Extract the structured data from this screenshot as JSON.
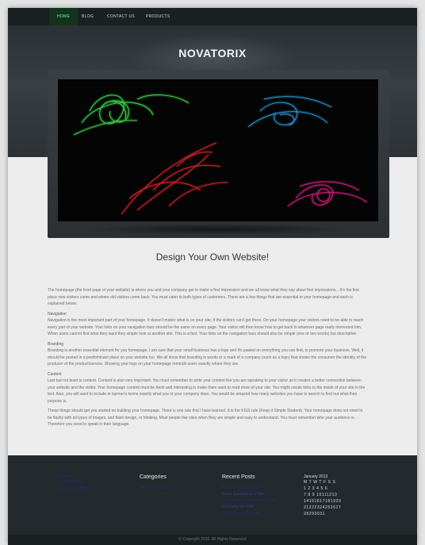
{
  "nav": {
    "items": [
      "HOME",
      "BLOG",
      "CONTACT US",
      "PRODUCTS"
    ]
  },
  "header": {
    "logo": "NOVATORIX"
  },
  "main": {
    "tagline": "Design Your Own Website!",
    "intro": "The homepage (the front page of your website) is where you and your company get to make a first impression and we all know what they say about first impressions... It's the first place new visitors come and where old visitors come back. You must cater to both types of customers. There are a few things that are essential to your homepage and each is explained below.",
    "sections": [
      {
        "heading": "Navigation",
        "text": "Navigation is the most important part of your homepage. It doesn't matter what is on your site, if the visitors can't get there. On your homepage your visitors need to be able to reach every part of your website. Your links on your navigation bars should be the same on every page. Your visitor will then know how to get back to whatever page really interested him. When users cannot find what they want they simple look at another site. This is a fact. Your links on the navigation bars should also be simple (one or two words) but descriptive."
      },
      {
        "heading": "Branding",
        "text": "Branding is another essential element for you homepage. I am sure that your small business has a logo and it's pasted on everything you can find, to promote your business. Well, it should be posted in a predominant place on your website too. We all know that branding is words or a mark of a company (such as a logo) that shows the consumer the identity of the producer of the product/service. Showing your logo on your homepage reminds users exactly where they are."
      },
      {
        "heading": "Content",
        "text": "Last but not least is content. Content is also very important. You must remember to write your content like you are speaking to your visitor as it creates a better connection between your website and the visitor. Your homepage content must be fresh and interesting to make them want to read more of your site. You might create links to the inside of your site in the text. Also, you will want to include in layman's terms exactly what you or your company does. You would be amazed how many websites you have to search to find out what their purpose is."
      }
    ],
    "closing": "These things should get you started on building your homepage. There is one rule that I have learned. It is the KISS rule (Keep it Simple Student). Your homepage does not need to be flashy with all types of images, and flash design, or blinking. Most people like sites when they are simple and easy to understand. You must remember who your audience is. Therefore you need to speak in their language."
  },
  "footer": {
    "links_col": [
      "Sitemap",
      "Privacy Policy",
      "Terms & Conditions"
    ],
    "categories_title": "Categories",
    "categories": [
      "Get Our Products"
    ],
    "recent_title": "Recent Posts",
    "recent": [
      {
        "text": "How The Big Idea Gets",
        "bright": false
      },
      {
        "text": "Great Success of a Man",
        "bright": true
      },
      {
        "text": "The World of the Internet Ages",
        "bright": false
      },
      {
        "text": "Browsing the Web",
        "bright": true
      },
      {
        "text": "Looking over Blogging",
        "bright": false
      }
    ],
    "calendar": {
      "title": "January 2013",
      "header": "M T W T F S S",
      "rows": [
        "1 2 3 4 5 6",
        "7 8 9 10111213",
        "14151617181920",
        "21222324252627",
        "28293031"
      ]
    },
    "copyright": "© Copyright 2010. All Rights Reserved"
  },
  "colors": {
    "nav_bg": "#1b2023",
    "header_bg": "#2f363b",
    "footer_bg": "#23292c",
    "link": "#2e2a77"
  }
}
